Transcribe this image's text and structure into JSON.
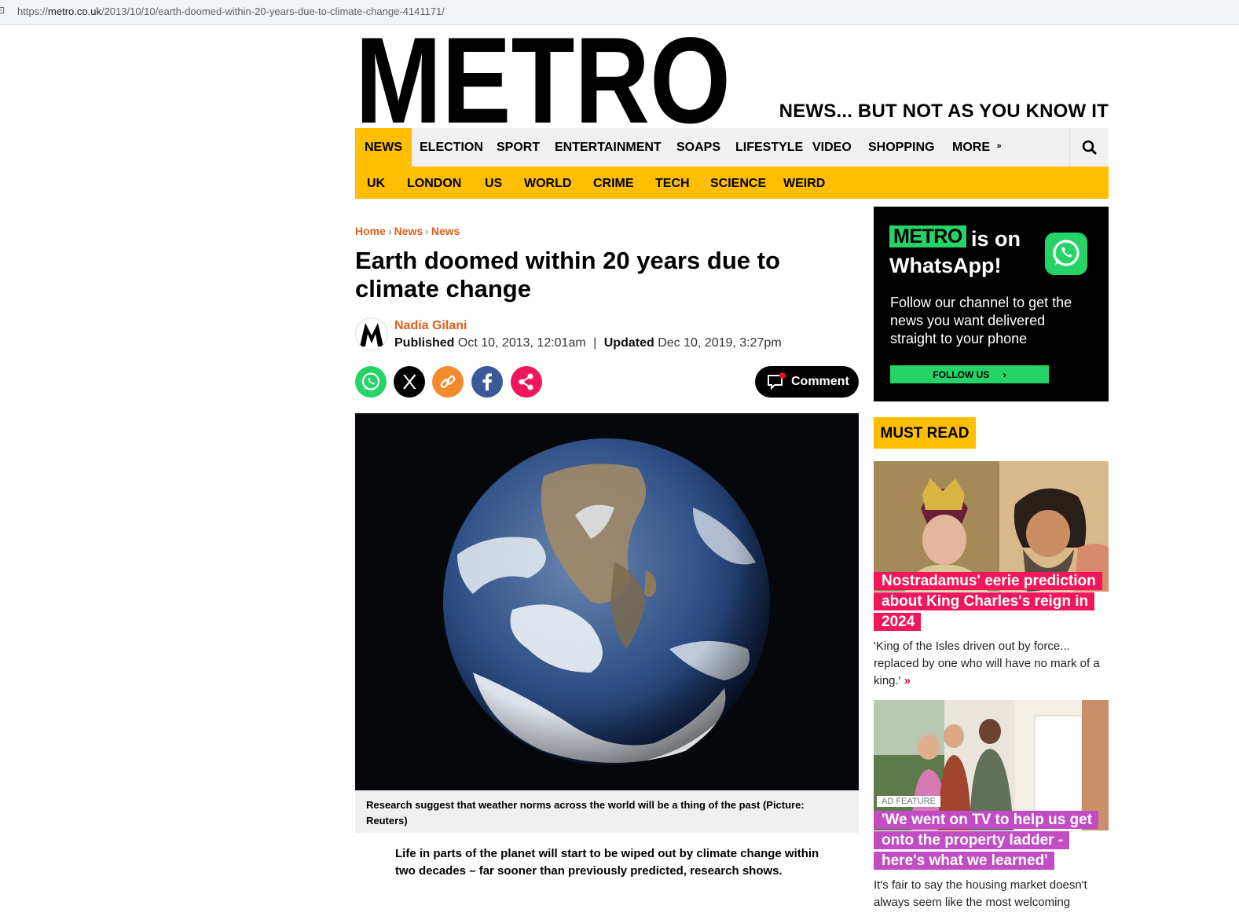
{
  "browser": {
    "url_prefix": "https://",
    "url_host": "metro.co.uk",
    "url_path": "/2013/10/10/earth-doomed-within-20-years-due-to-climate-change-4141171/"
  },
  "header": {
    "logo_text": "METRO",
    "tagline": "NEWS... BUT NOT AS YOU KNOW IT"
  },
  "nav": {
    "primary": [
      "NEWS",
      "ELECTION",
      "SPORT",
      "ENTERTAINMENT",
      "SOAPS",
      "LIFESTYLE",
      "VIDEO",
      "SHOPPING",
      "MORE"
    ],
    "secondary": [
      "UK",
      "LONDON",
      "US",
      "WORLD",
      "CRIME",
      "TECH",
      "SCIENCE",
      "WEIRD"
    ]
  },
  "breadcrumb": [
    "Home",
    "News",
    "News"
  ],
  "article": {
    "title": "Earth doomed within 20 years due to climate change",
    "author": "Nadia Gilani",
    "published_label": "Published",
    "published": "Oct 10, 2013, 12:01am",
    "divider": "|",
    "updated_label": "Updated",
    "updated": "Dec 10, 2019, 3:27pm",
    "comment_label": "Comment",
    "caption": "Research suggest that weather norms across the world will be a thing of the past (Picture: Reuters)",
    "lede": "Life in parts of the planet will start to be wiped out by climate change within two decades – far sooner than previously predicted, research shows."
  },
  "share_icons": [
    "whatsapp-icon",
    "x-icon",
    "link-icon",
    "facebook-icon",
    "share-icon"
  ],
  "whatsapp_promo": {
    "brand": "METRO",
    "is_on": "is on",
    "whatsapp": "WhatsApp!",
    "text": "Follow our channel to get the news you want delivered straight to your phone",
    "follow": "FOLLOW US"
  },
  "must_read": {
    "label": "MUST READ",
    "cards": [
      {
        "headline": "Nostradamus' eerie prediction about King Charles's reign in 2024",
        "blurb": "'King of the Isles driven out by force... replaced by one who will have no mark of a king.'",
        "more": "»"
      },
      {
        "ad_tag": "AD FEATURE",
        "headline": "'We went on TV to help us get onto the property ladder - here's what we learned'",
        "blurb": "It's fair to say the housing market doesn't always seem like the most welcoming"
      }
    ]
  },
  "colors": {
    "brand_yellow": "#ffbe00",
    "link_orange": "#e0601c",
    "headline_pink": "#f0185a",
    "ad_purple": "#c14cc4",
    "whatsapp_green": "#25d366"
  }
}
